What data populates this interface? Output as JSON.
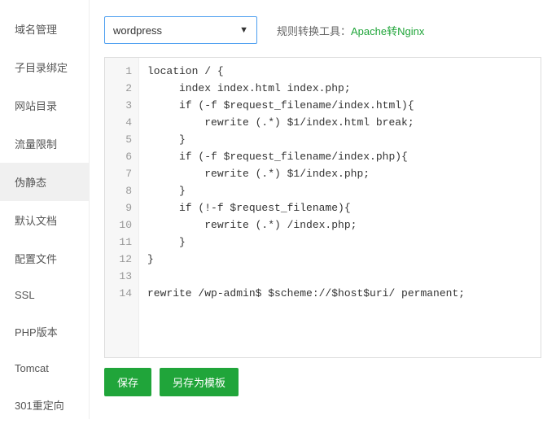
{
  "sidebar": {
    "items": [
      {
        "label": "域名管理"
      },
      {
        "label": "子目录绑定"
      },
      {
        "label": "网站目录"
      },
      {
        "label": "流量限制"
      },
      {
        "label": "伪静态"
      },
      {
        "label": "默认文档"
      },
      {
        "label": "配置文件"
      },
      {
        "label": "SSL"
      },
      {
        "label": "PHP版本"
      },
      {
        "label": "Tomcat"
      },
      {
        "label": "301重定向"
      }
    ],
    "active_index": 4
  },
  "topbar": {
    "select_value": "wordpress",
    "converter_label": "规则转换工具：",
    "converter_link": "Apache转Nginx"
  },
  "editor": {
    "lines": [
      "location / {",
      "     index index.html index.php;",
      "     if (-f $request_filename/index.html){",
      "         rewrite (.*) $1/index.html break;",
      "     }",
      "     if (-f $request_filename/index.php){",
      "         rewrite (.*) $1/index.php;",
      "     }",
      "     if (!-f $request_filename){",
      "         rewrite (.*) /index.php;",
      "     }",
      "}",
      "",
      "rewrite /wp-admin$ $scheme://$host$uri/ permanent;"
    ]
  },
  "buttons": {
    "save": "保存",
    "save_as_template": "另存为模板"
  }
}
